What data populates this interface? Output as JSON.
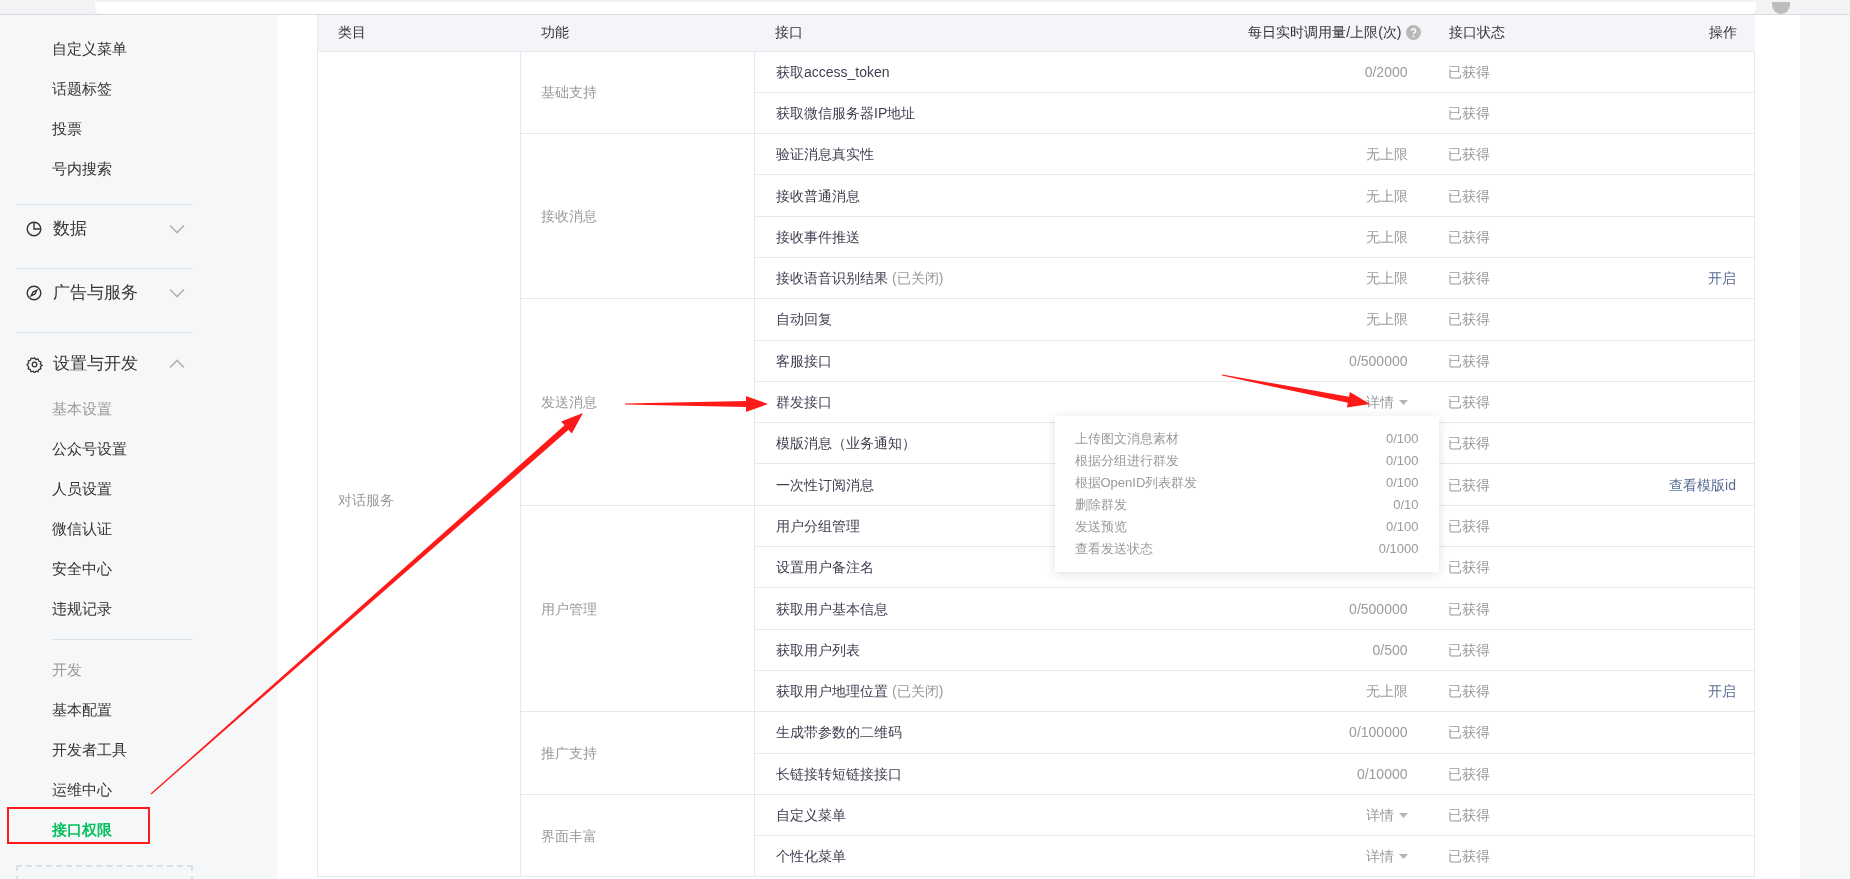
{
  "sidebar": {
    "items": [
      {
        "kind": "item",
        "label": "自定义菜单",
        "selected": false
      },
      {
        "kind": "item",
        "label": "话题标签",
        "selected": false
      },
      {
        "kind": "item",
        "label": "投票",
        "selected": false
      },
      {
        "kind": "item",
        "label": "号内搜索",
        "selected": false
      },
      {
        "kind": "divider"
      },
      {
        "kind": "menu",
        "label": "数据",
        "expanded": false
      },
      {
        "kind": "divider"
      },
      {
        "kind": "menu",
        "label": "广告与服务",
        "expanded": false
      },
      {
        "kind": "divider"
      },
      {
        "kind": "menu",
        "label": "设置与开发",
        "expanded": true
      },
      {
        "kind": "heading",
        "label": "基本设置"
      },
      {
        "kind": "item",
        "label": "公众号设置",
        "selected": false
      },
      {
        "kind": "item",
        "label": "人员设置",
        "selected": false
      },
      {
        "kind": "item",
        "label": "微信认证",
        "selected": false
      },
      {
        "kind": "item",
        "label": "安全中心",
        "selected": false
      },
      {
        "kind": "item",
        "label": "违规记录",
        "selected": false
      },
      {
        "kind": "subdivider"
      },
      {
        "kind": "heading",
        "label": "开发"
      },
      {
        "kind": "item",
        "label": "基本配置",
        "selected": false
      },
      {
        "kind": "item",
        "label": "开发者工具",
        "selected": false
      },
      {
        "kind": "item",
        "label": "运维中心",
        "selected": false
      },
      {
        "kind": "item",
        "label": "接口权限",
        "selected": true
      }
    ]
  },
  "table": {
    "columns": [
      {
        "label": "类目",
        "help": false
      },
      {
        "label": "功能",
        "help": false
      },
      {
        "label": "接口",
        "help": false
      },
      {
        "label": "每日实时调用量/上限(次)",
        "help": true
      },
      {
        "label": "接口状态",
        "help": false
      },
      {
        "label": "操作",
        "help": false
      }
    ],
    "categories": [
      {
        "name": "对话服务",
        "features": [
          {
            "name": "基础支持",
            "apis": [
              {
                "name": "获取access_token",
                "kind": "plain",
                "quota": "0/2000",
                "status": "已获得"
              },
              {
                "name": "获取微信服务器IP地址",
                "status": "已获得"
              }
            ]
          },
          {
            "name": "接收消息",
            "apis": [
              {
                "name": "验证消息真实性",
                "kind": "plain",
                "quota": "无上限",
                "status": "已获得"
              },
              {
                "name": "接收普通消息",
                "kind": "plain",
                "quota": "无上限",
                "status": "已获得"
              },
              {
                "name": "接收事件推送",
                "kind": "plain",
                "quota": "无上限",
                "status": "已获得"
              },
              {
                "name": "接收语音识别结果",
                "note": "(已关闭)",
                "kind": "plain",
                "quota": "无上限",
                "status": "已获得",
                "action": "开启"
              }
            ]
          },
          {
            "name": "发送消息",
            "apis": [
              {
                "name": "自动回复",
                "kind": "plain",
                "quota": "无上限",
                "status": "已获得"
              },
              {
                "name": "客服接口",
                "kind": "plain",
                "quota": "0/500000",
                "status": "已获得"
              },
              {
                "name": "群发接口",
                "kind": "dropdown",
                "quota": "详情",
                "status": "已获得",
                "popover": [
                  {
                    "label": "上传图文消息素材",
                    "value": "0/100"
                  },
                  {
                    "label": "根据分组进行群发",
                    "value": "0/100"
                  },
                  {
                    "label": "根据OpenID列表群发",
                    "value": "0/100"
                  },
                  {
                    "label": "删除群发",
                    "value": "0/10"
                  },
                  {
                    "label": "发送预览",
                    "value": "0/100"
                  },
                  {
                    "label": "查看发送状态",
                    "value": "0/1000"
                  }
                ]
              },
              {
                "name": "模版消息（业务通知）",
                "status": "已获得"
              },
              {
                "name": "一次性订阅消息",
                "status": "已获得",
                "action": "查看模版id"
              }
            ]
          },
          {
            "name": "用户管理",
            "apis": [
              {
                "name": "用户分组管理",
                "status": "已获得"
              },
              {
                "name": "设置用户备注名",
                "status": "已获得"
              },
              {
                "name": "获取用户基本信息",
                "kind": "plain",
                "quota": "0/500000",
                "status": "已获得"
              },
              {
                "name": "获取用户列表",
                "kind": "plain",
                "quota": "0/500",
                "status": "已获得"
              },
              {
                "name": "获取用户地理位置",
                "note": "(已关闭)",
                "kind": "plain",
                "quota": "无上限",
                "status": "已获得",
                "action": "开启"
              }
            ]
          },
          {
            "name": "推广支持",
            "apis": [
              {
                "name": "生成带参数的二维码",
                "kind": "plain",
                "quota": "0/100000",
                "status": "已获得"
              },
              {
                "name": "长链接转短链接接口",
                "kind": "plain",
                "quota": "0/10000",
                "status": "已获得"
              }
            ]
          },
          {
            "name": "界面丰富",
            "apis": [
              {
                "name": "自定义菜单",
                "kind": "dropdown",
                "quota": "详情",
                "status": "已获得"
              },
              {
                "name": "个性化菜单",
                "kind": "dropdown",
                "quota": "详情",
                "status": "已获得"
              }
            ]
          }
        ]
      }
    ]
  }
}
